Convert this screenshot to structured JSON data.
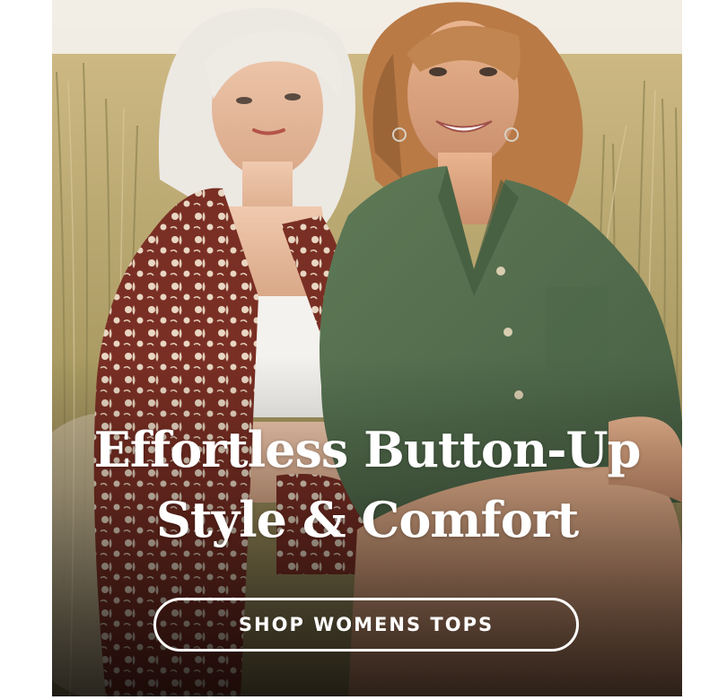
{
  "hero": {
    "title_line1": "Effortless Button-Up",
    "title_line2": "Style & Comfort",
    "cta_label": "SHOP WOMENS TOPS"
  },
  "colors": {
    "overlay_text": "#ffffff",
    "shirt_green": "#56704f",
    "shirt_print_red": "#7a2f24",
    "grass": "#b9a66a",
    "sky": "#eee8dc"
  }
}
